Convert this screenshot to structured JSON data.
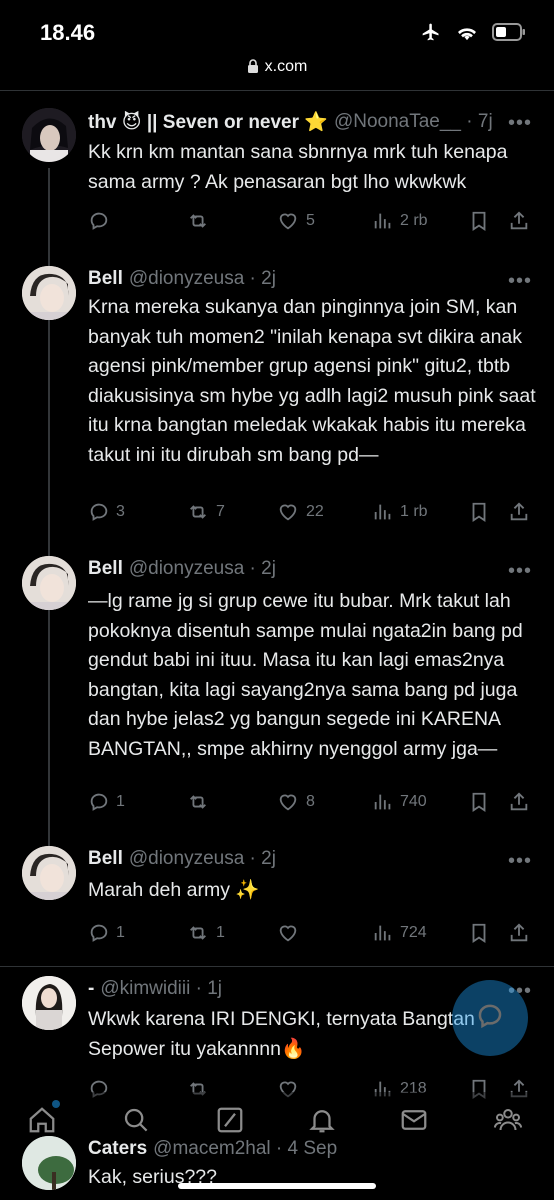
{
  "status_bar": {
    "time": "18.46",
    "url": "x.com"
  },
  "tweets": [
    {
      "name": "thv 😈 || Seven or never ⭐",
      "handle": "@NoonaTae__ · 7j",
      "text": "Kk krn km mantan sana sbnrnya mrk tuh kenapa sama army ? Ak penasaran bgt lho wkwkwk",
      "replies": "",
      "reposts": "",
      "likes": "5",
      "views": "2 rb"
    },
    {
      "name": "Bell",
      "handle": "@dionyzeusa · 2j",
      "text": "Krna mereka sukanya dan pinginnya join SM, kan banyak tuh momen2 \"inilah kenapa svt dikira anak agensi pink/member grup agensi pink\" gitu2, tbtb diakusisinya sm hybe yg adlh lagi2 musuh pink saat itu krna bangtan meledak wkakak habis itu mereka takut ini itu dirubah sm bang pd—",
      "replies": "3",
      "reposts": "7",
      "likes": "22",
      "views": "1 rb"
    },
    {
      "name": "Bell",
      "handle": "@dionyzeusa · 2j",
      "text": "—lg rame jg si grup cewe itu bubar. Mrk takut lah pokoknya disentuh sampe mulai ngata2in bang pd gendut babi ini ituu. Masa itu kan lagi emas2nya bangtan, kita lagi sayang2nya sama bang pd juga dan hybe jelas2 yg bangun segede ini KARENA BANGTAN,, smpe akhirny nyenggol army jga—",
      "replies": "1",
      "reposts": "",
      "likes": "8",
      "views": "740"
    },
    {
      "name": "Bell",
      "handle": "@dionyzeusa · 2j",
      "text": "Marah deh army ✨",
      "replies": "1",
      "reposts": "1",
      "likes": "",
      "views": "724"
    },
    {
      "name": "-",
      "handle": "@kimwidiii · 1j",
      "text": "Wkwk karena IRI DENGKI, ternyata Bangtan Sepower itu yakannnn🔥",
      "replies": "",
      "reposts": "",
      "likes": "",
      "views": "218"
    },
    {
      "name": "Caters",
      "handle": "@macem2hal · 4 Sep",
      "text": "Kak, serius???",
      "replies": "",
      "reposts": "",
      "likes": "",
      "views": ""
    }
  ],
  "icons": {
    "reply": "reply-icon",
    "repost": "repost-icon",
    "like": "heart-icon",
    "views": "views-icon",
    "bookmark": "bookmark-icon",
    "share": "share-icon"
  },
  "tabs": [
    "home-icon",
    "search-icon",
    "grok-icon",
    "notifications-icon",
    "messages-icon",
    "communities-icon"
  ],
  "colors": {
    "background": "#000000",
    "secondary_text": "#71767b",
    "accent": "#1d9bf0"
  }
}
